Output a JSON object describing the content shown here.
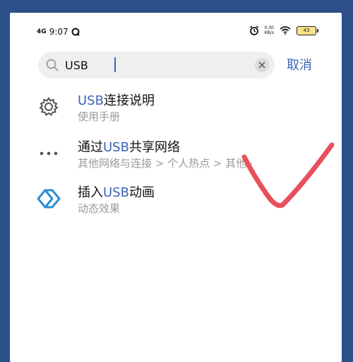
{
  "status_bar": {
    "signal": "4G",
    "time": "9:07",
    "speed_value": "0.00",
    "speed_unit": "KB/s",
    "battery": "43"
  },
  "search": {
    "query": "USB",
    "cancel_label": "取消"
  },
  "results": [
    {
      "title_pre": "",
      "title_highlight": "USB",
      "title_post": "连接说明",
      "subtitle": "使用手册",
      "icon": "gear-icon"
    },
    {
      "title_pre": "通过",
      "title_highlight": "USB",
      "title_post": "共享网络",
      "subtitle": "其他网络与连接 > 个人热点 > 其他··",
      "icon": "more-dots-icon"
    },
    {
      "title_pre": "插入",
      "title_highlight": "USB",
      "title_post": "动画",
      "subtitle": "动态效果",
      "icon": "diamond-animation-icon"
    }
  ],
  "colors": {
    "accent": "#3d63b8",
    "frame": "#2d4f88",
    "check_mark": "#e8505b"
  }
}
